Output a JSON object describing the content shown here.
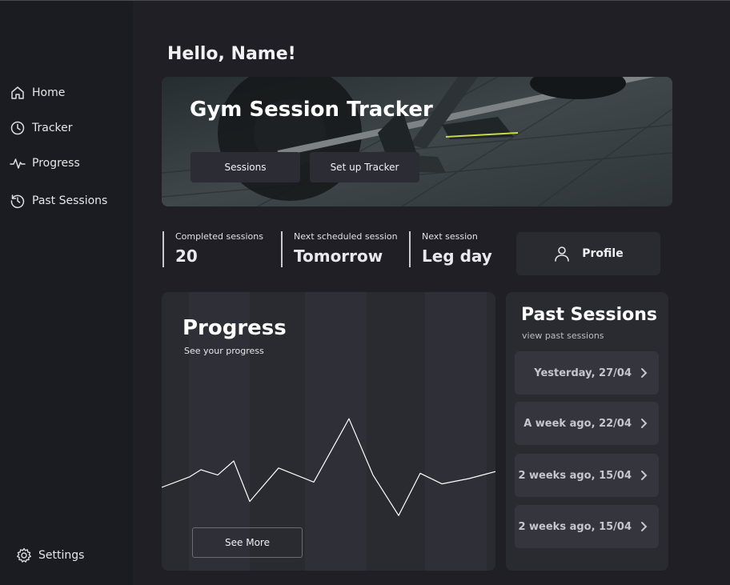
{
  "greeting": "Hello, Name!",
  "sidebar": {
    "items": [
      {
        "label": "Home",
        "icon": "home-icon"
      },
      {
        "label": "Tracker",
        "icon": "clock-icon"
      },
      {
        "label": "Progress",
        "icon": "activity-icon"
      },
      {
        "label": "Past Sessions",
        "icon": "history-icon"
      }
    ],
    "settings": {
      "label": "Settings",
      "icon": "gear-icon"
    }
  },
  "hero": {
    "title": "Gym Session Tracker",
    "buttons": {
      "sessions": "Sessions",
      "setup": "Set up Tracker"
    }
  },
  "stats": [
    {
      "label": "Completed sessions",
      "value": "20"
    },
    {
      "label": "Next scheduled session",
      "value": "Tomorrow"
    },
    {
      "label": "Next session",
      "value": "Leg day"
    }
  ],
  "profile": {
    "label": "Profile",
    "icon": "user-icon"
  },
  "progress": {
    "title": "Progress",
    "subtitle": "See your progress",
    "see_more": "See More"
  },
  "chart_data": {
    "type": "line",
    "title": "",
    "xlabel": "",
    "ylabel": "",
    "grid": false,
    "values": [
      30,
      36,
      40,
      37,
      45,
      22,
      41,
      33,
      69,
      37,
      14,
      38,
      32,
      35,
      39
    ]
  },
  "past_sessions": {
    "title": "Past Sessions",
    "subtitle": "view past sessions",
    "items": [
      {
        "label": "Yesterday, 27/04"
      },
      {
        "label": "A week ago, 22/04"
      },
      {
        "label": "2 weeks ago, 15/04"
      },
      {
        "label": "2 weeks ago, 15/04"
      }
    ]
  },
  "colors": {
    "background": "#1f1f25",
    "sidebar": "#1b1c22",
    "card": "#2a2a31",
    "item": "#35353d",
    "text": "#ffffff"
  }
}
